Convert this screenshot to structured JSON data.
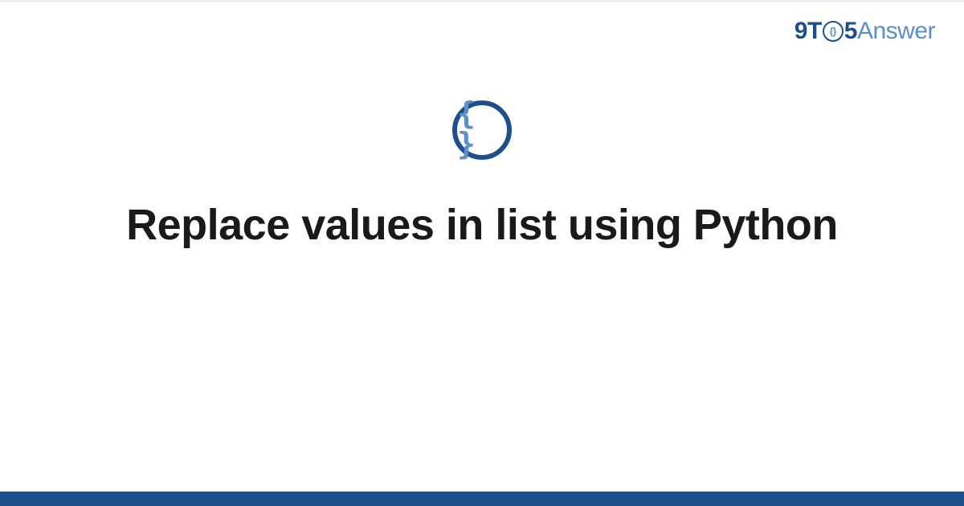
{
  "brand": {
    "part_nine": "9",
    "part_t": "T",
    "part_o_inner": "{}",
    "part_five": "5",
    "part_answer": "Answer"
  },
  "icon": {
    "braces_glyph": "{ }"
  },
  "title": "Replace values in list using Python",
  "colors": {
    "primary_dark": "#1d4f8c",
    "primary_light": "#5a8fc7",
    "text": "#1a1a1a",
    "bg": "#ffffff"
  }
}
